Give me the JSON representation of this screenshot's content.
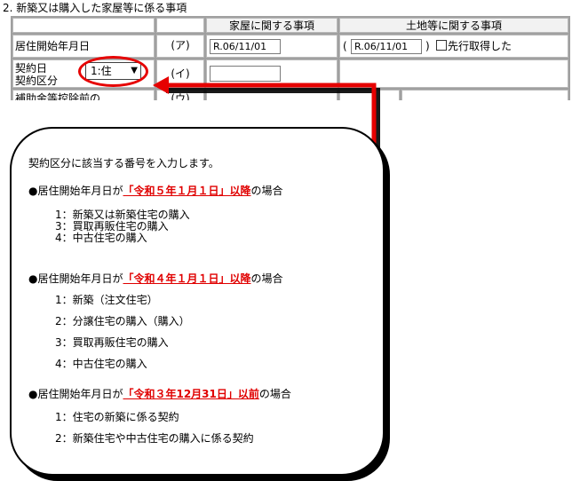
{
  "section": {
    "title": "2. 新築又は購入した家屋等に係る事項"
  },
  "table": {
    "col_house": "家屋に関する事項",
    "col_land": "土地等に関する事項",
    "rows": [
      {
        "label": "居住開始年月日",
        "mark": "(ア)",
        "house_value": "R.06/11/01",
        "land_open": "(",
        "land_value": "R.06/11/01",
        "land_close": ")",
        "checkbox_label": "先行取得した"
      },
      {
        "label_line1": "契約日",
        "label_line2": "契約区分",
        "mark": "(イ)",
        "select_value": "1:住",
        "house_value": ""
      },
      {
        "label": "補助金等控除前の",
        "mark": "(ウ)"
      }
    ]
  },
  "callout": {
    "intro": "契約区分に該当する番号を入力します。",
    "groups": [
      {
        "prefix": "●居住開始年月日が",
        "date": "「令和５年１月１日」以降",
        "suffix": "の場合",
        "items": [
          "1：新築又は新築住宅の購入",
          "3：買取再販住宅の購入",
          "4：中古住宅の購入"
        ]
      },
      {
        "prefix": "●居住開始年月日が",
        "date": "「令和４年１月１日」以降",
        "suffix": "の場合",
        "items": [
          "1：新築（注文住宅）",
          "2：分譲住宅の購入（購入）",
          "3：買取再販住宅の購入",
          "4：中古住宅の購入"
        ]
      },
      {
        "prefix": "●居住開始年月日が",
        "date": "「令和３年12月31日」以前",
        "suffix": "の場合",
        "items": [
          "1：住宅の新築に係る契約",
          "2：新築住宅や中古住宅の購入に係る契約"
        ]
      }
    ]
  },
  "colors": {
    "highlight": "#e60000",
    "text_red": "#e00000",
    "grid": "#a0a0a0"
  }
}
